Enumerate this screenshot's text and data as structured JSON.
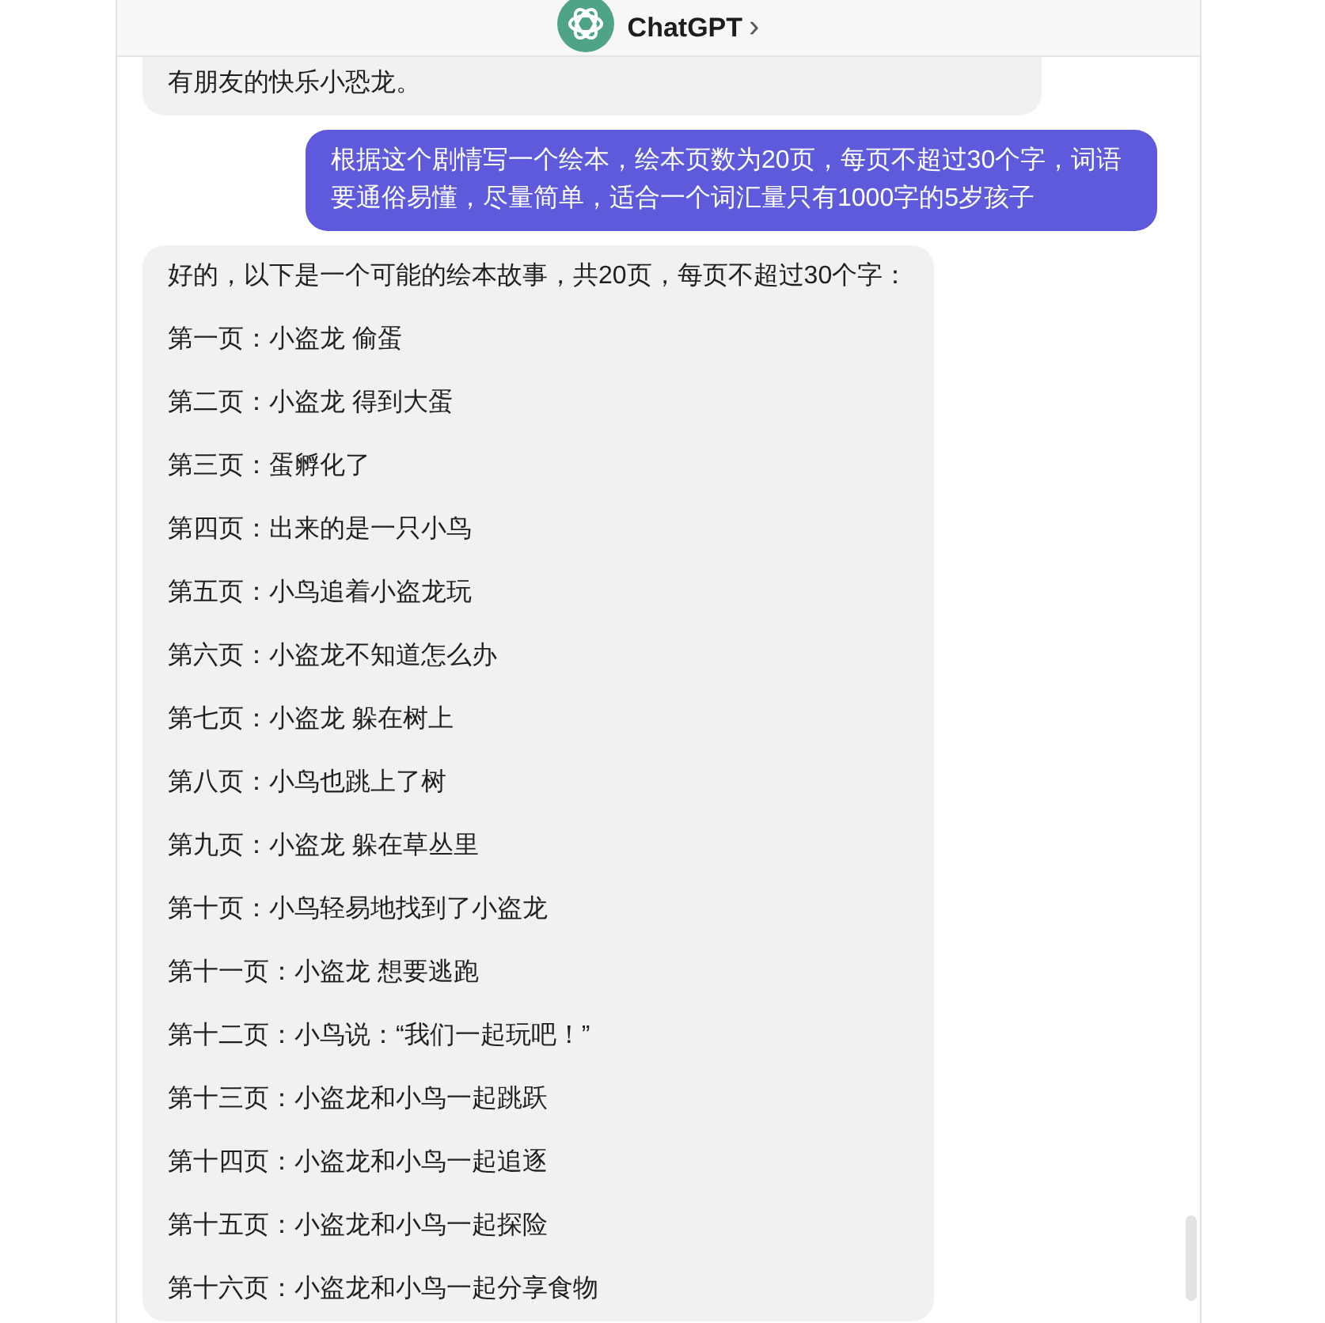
{
  "header": {
    "title": "ChatGPT",
    "chevron": "›"
  },
  "messages": [
    {
      "kind": "assistant",
      "paragraphs": [
        "有朋友的快乐小恐龙。"
      ],
      "cut_top": true
    },
    {
      "kind": "user",
      "paragraphs": [
        "根据这个剧情写一个绘本，绘本页数为20页，每页不超过30个字，词语要通俗易懂，尽量简单，适合一个词汇量只有1000字的5岁孩子"
      ],
      "cut_top": false
    },
    {
      "kind": "assistant",
      "paragraphs": [
        "好的，以下是一个可能的绘本故事，共20页，每页不超过30个字：",
        "第一页：小盗龙 偷蛋",
        "第二页：小盗龙 得到大蛋",
        "第三页：蛋孵化了",
        "第四页：出来的是一只小鸟",
        "第五页：小鸟追着小盗龙玩",
        "第六页：小盗龙不知道怎么办",
        "第七页：小盗龙 躲在树上",
        "第八页：小鸟也跳上了树",
        "第九页：小盗龙 躲在草丛里",
        "第十页：小鸟轻易地找到了小盗龙",
        "第十一页：小盗龙 想要逃跑",
        "第十二页：小鸟说：“我们一起玩吧！”",
        "第十三页：小盗龙和小鸟一起跳跃",
        "第十四页：小盗龙和小鸟一起追逐",
        "第十五页：小盗龙和小鸟一起探险",
        "第十六页：小盗龙和小鸟一起分享食物"
      ],
      "cut_top": false
    }
  ]
}
